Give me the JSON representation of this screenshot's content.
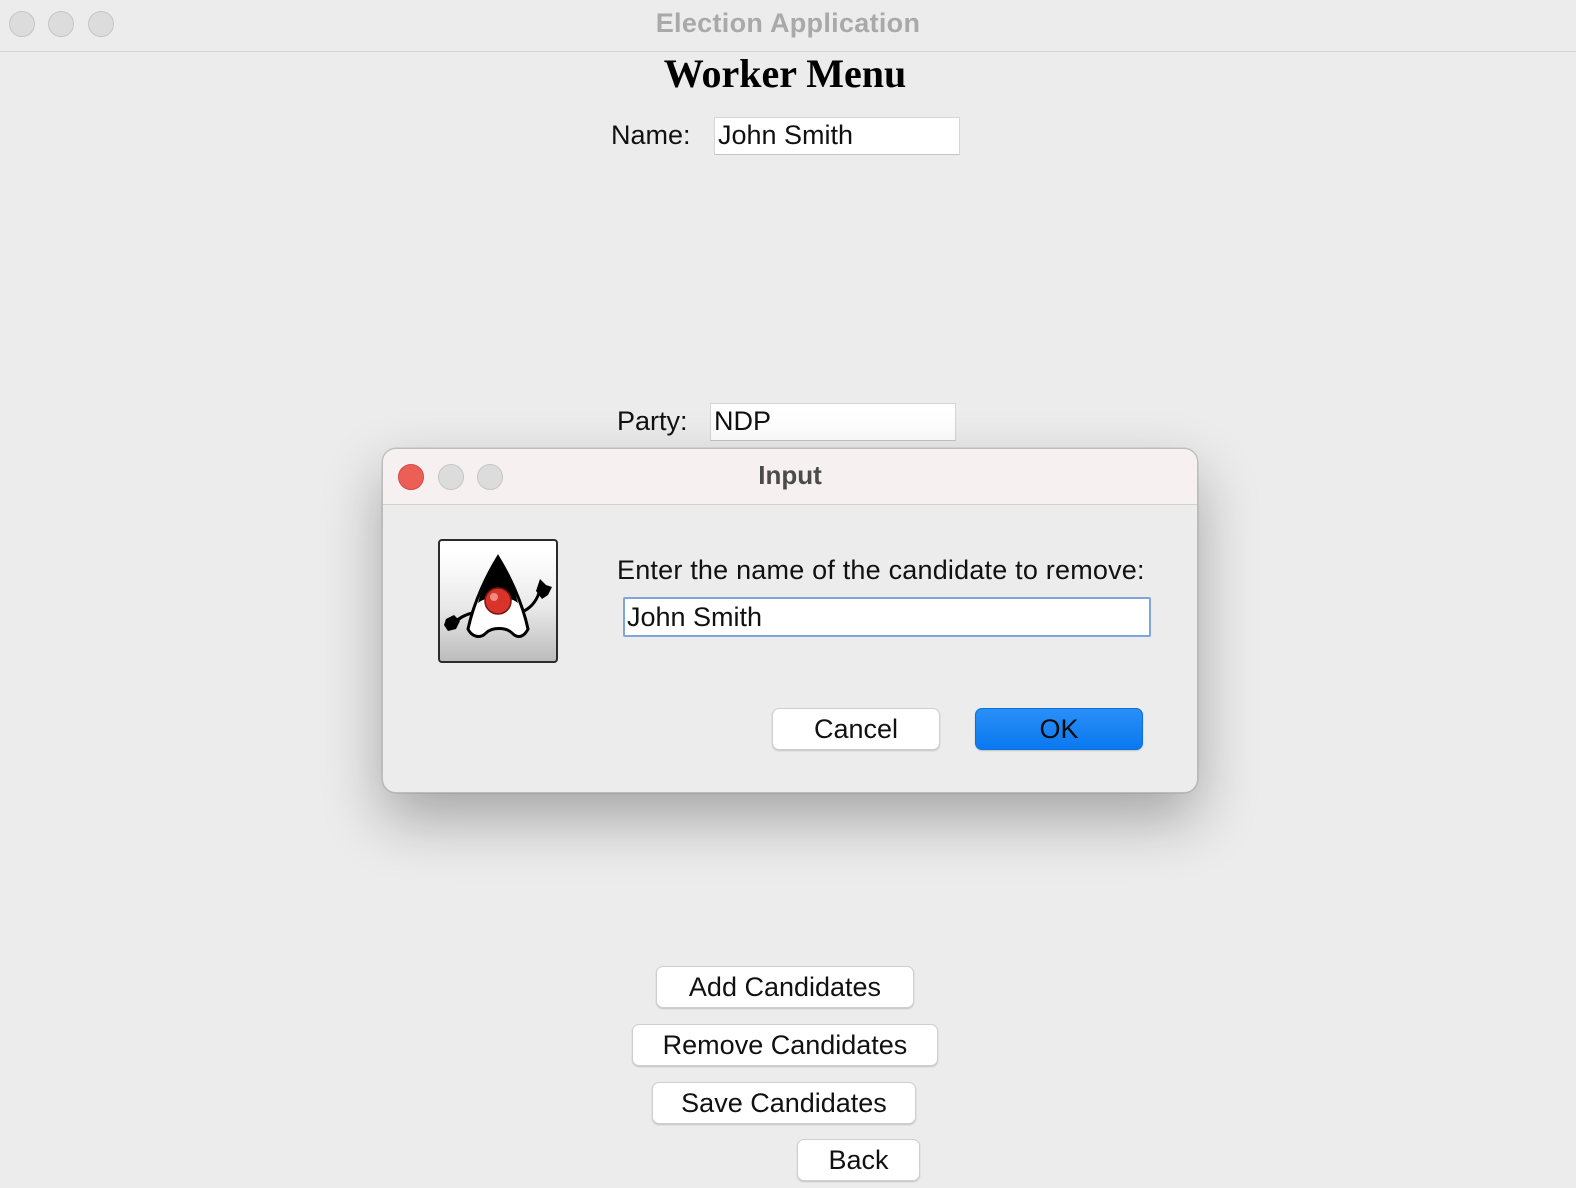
{
  "window": {
    "title": "Election Application"
  },
  "worker_menu": {
    "heading": "Worker Menu",
    "name_label": "Name:",
    "name_value": "John Smith",
    "party_label": "Party:",
    "party_value": "NDP",
    "buttons": {
      "add": "Add Candidates",
      "remove": "Remove Candidates",
      "save": "Save Candidates",
      "back": "Back"
    }
  },
  "dialog": {
    "title": "Input",
    "icon": "java-duke-icon",
    "prompt": "Enter the name of the candidate to remove:",
    "input_value": "John Smith",
    "cancel_label": "Cancel",
    "ok_label": "OK",
    "ok_color": "#0a78f0",
    "close_color": "#ec5f57"
  }
}
